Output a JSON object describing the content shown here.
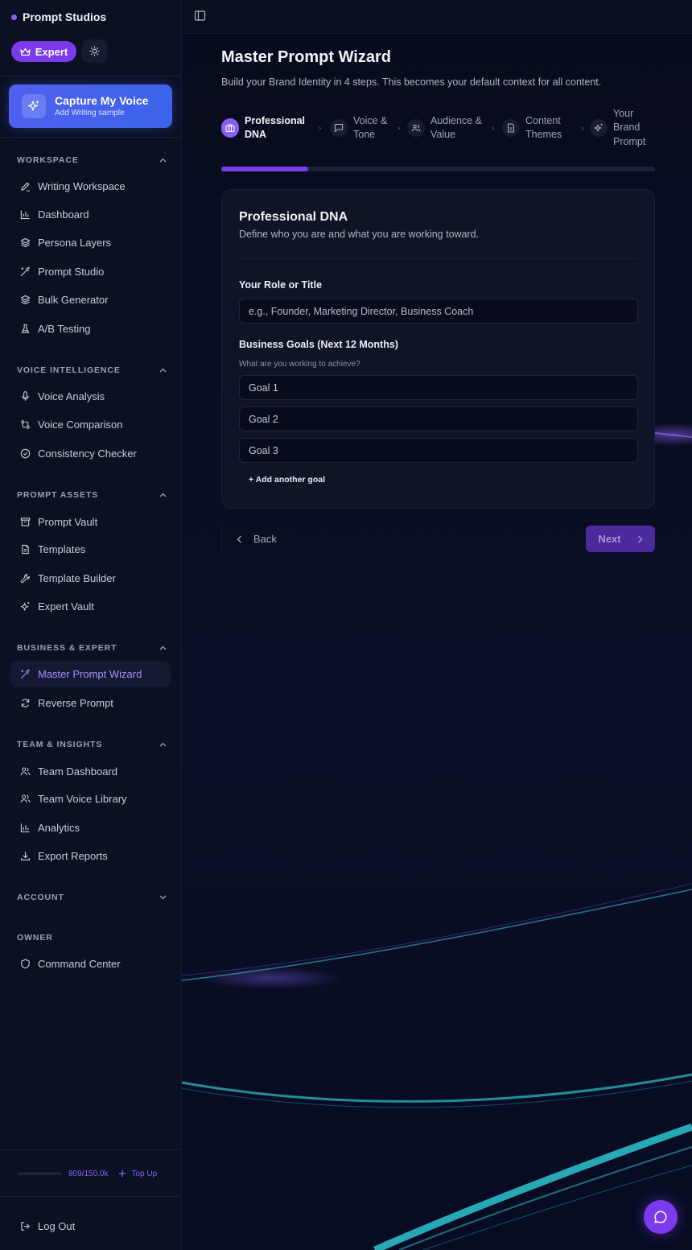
{
  "app": {
    "brand": "Prompt Studios"
  },
  "sidebar": {
    "expert_label": "Expert",
    "capture": {
      "title": "Capture My Voice",
      "subtitle": "Add Writing sample"
    },
    "sections": [
      {
        "title": "WORKSPACE",
        "items": [
          "Writing Workspace",
          "Dashboard",
          "Persona Layers",
          "Prompt Studio",
          "Bulk Generator",
          "A/B Testing"
        ]
      },
      {
        "title": "VOICE INTELLIGENCE",
        "items": [
          "Voice Analysis",
          "Voice Comparison",
          "Consistency Checker"
        ]
      },
      {
        "title": "PROMPT ASSETS",
        "items": [
          "Prompt Vault",
          "Templates",
          "Template Builder",
          "Expert Vault"
        ]
      },
      {
        "title": "BUSINESS & EXPERT",
        "items": [
          "Master Prompt Wizard",
          "Reverse Prompt"
        ]
      },
      {
        "title": "TEAM & INSIGHTS",
        "items": [
          "Team Dashboard",
          "Team Voice Library",
          "Analytics",
          "Export Reports"
        ]
      },
      {
        "title": "ACCOUNT",
        "items": []
      },
      {
        "title": "OWNER",
        "items": [
          "Command Center"
        ]
      }
    ],
    "credits": {
      "value": "809/150.0k",
      "used_fraction": 0.005,
      "topup_label": "Top Up"
    },
    "logout_label": "Log Out"
  },
  "wizard": {
    "title": "Master Prompt Wizard",
    "subtitle": "Build your Brand Identity in 4 steps. This becomes your default context for all content.",
    "steps": [
      {
        "lines": [
          "Professional",
          "DNA"
        ],
        "active": true
      },
      {
        "lines": [
          "Voice &",
          "Tone"
        ],
        "active": false
      },
      {
        "lines": [
          "Audience &",
          "Value"
        ],
        "active": false
      },
      {
        "lines": [
          "Content",
          "Themes"
        ],
        "active": false
      },
      {
        "lines": [
          "Your",
          "Brand",
          "Prompt"
        ],
        "active": false
      }
    ],
    "progress": 0.2,
    "card": {
      "title": "Professional DNA",
      "subtitle": "Define who you are and what you are working toward.",
      "role_label": "Your Role or Title",
      "role_placeholder": "e.g., Founder, Marketing Director, Business Coach",
      "goals_label": "Business Goals (Next 12 Months)",
      "goals_help": "What are you working to achieve?",
      "goals": [
        "Goal 1",
        "Goal 2",
        "Goal 3"
      ],
      "add_goal": "+ Add another goal"
    },
    "back_label": "Back",
    "next_label": "Next"
  }
}
